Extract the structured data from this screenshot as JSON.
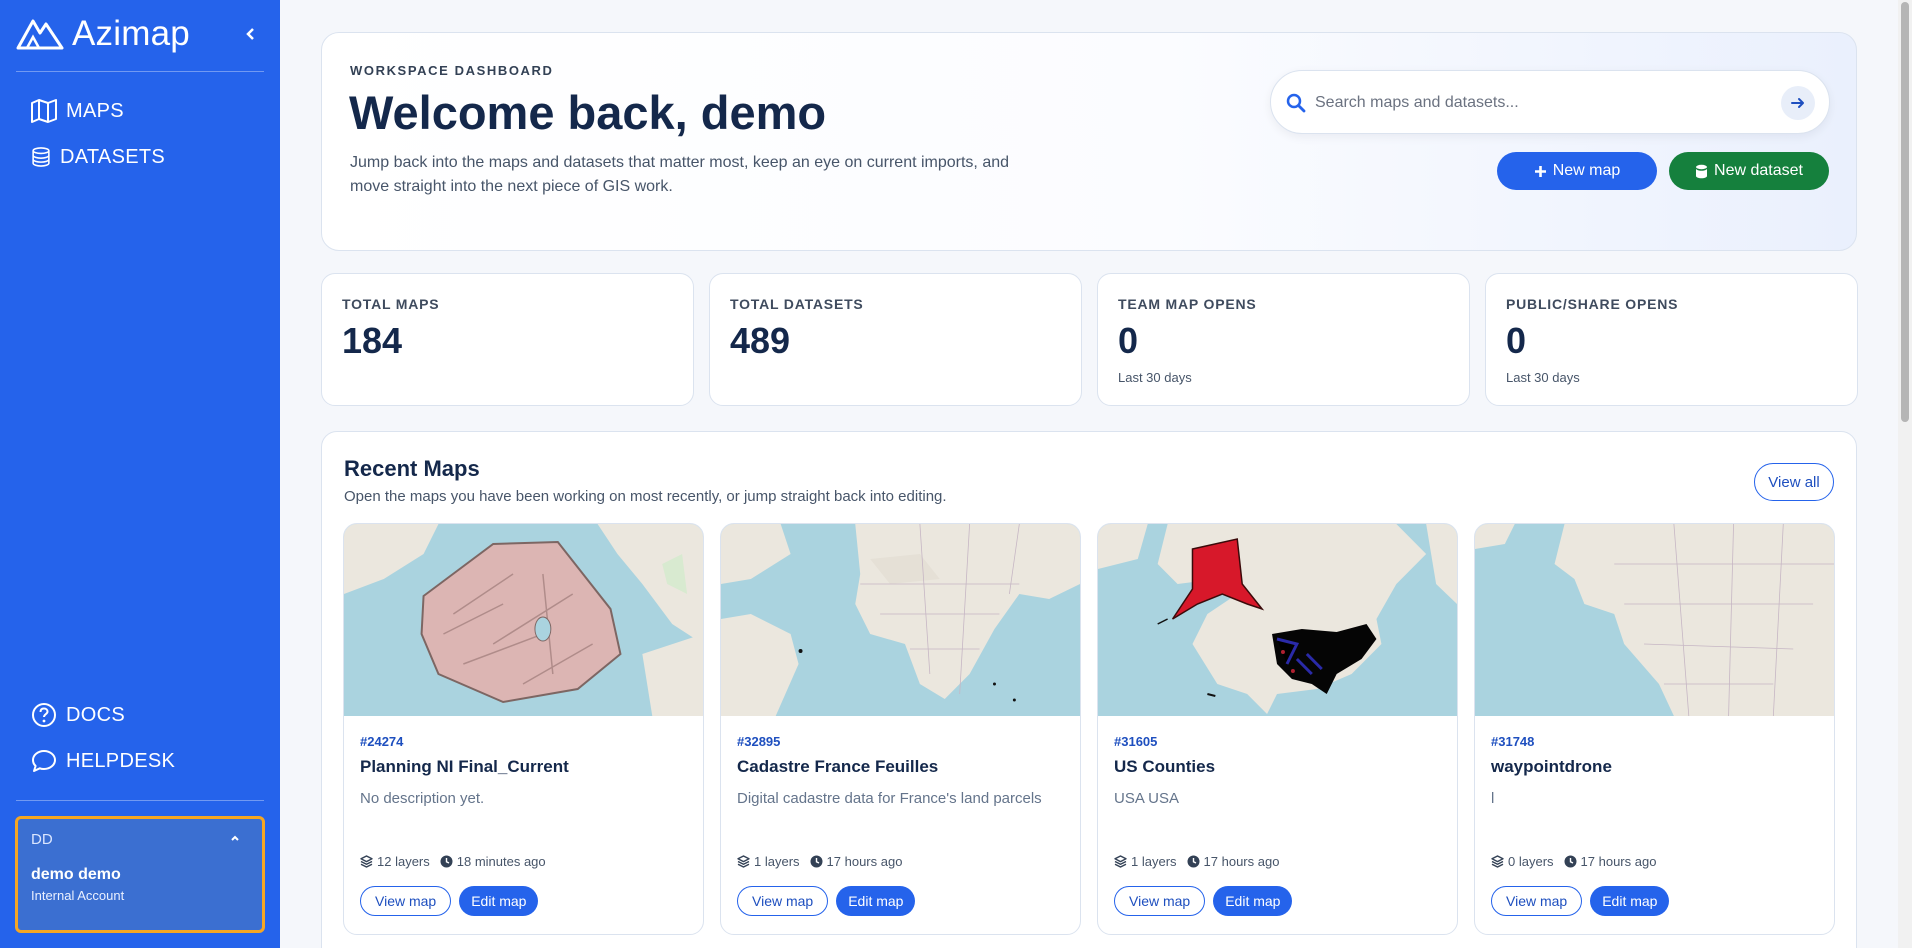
{
  "sidebar": {
    "brand": "Azimap",
    "nav": [
      {
        "label": "MAPS",
        "icon": "map-icon"
      },
      {
        "label": "DATASETS",
        "icon": "database-icon"
      }
    ],
    "footer_nav": [
      {
        "label": "DOCS",
        "icon": "question-circle-icon"
      },
      {
        "label": "HELPDESK",
        "icon": "chat-bubble-icon"
      }
    ],
    "user": {
      "initials": "DD",
      "name": "demo demo",
      "role": "Internal Account"
    }
  },
  "hero": {
    "eyebrow": "WORKSPACE DASHBOARD",
    "title": "Welcome back, demo",
    "description": "Jump back into the maps and datasets that matter most, keep an eye on current imports, and move straight into the next piece of GIS work.",
    "search_placeholder": "Search maps and datasets...",
    "new_map_label": "New map",
    "new_dataset_label": "New dataset"
  },
  "stats": [
    {
      "label": "TOTAL MAPS",
      "value": "184",
      "sub": ""
    },
    {
      "label": "TOTAL DATASETS",
      "value": "489",
      "sub": ""
    },
    {
      "label": "TEAM MAP OPENS",
      "value": "0",
      "sub": "Last 30 days"
    },
    {
      "label": "PUBLIC/SHARE OPENS",
      "value": "0",
      "sub": "Last 30 days"
    }
  ],
  "recent": {
    "title": "Recent Maps",
    "subtitle": "Open the maps you have been working on most recently, or jump straight back into editing.",
    "view_all": "View all",
    "view_label": "View map",
    "edit_label": "Edit map",
    "cards": [
      {
        "id": "#24274",
        "title": "Planning NI Final_Current",
        "description": "No description yet.",
        "layers": "12 layers",
        "updated": "18 minutes ago"
      },
      {
        "id": "#32895",
        "title": "Cadastre France Feuilles",
        "description": "Digital cadastre data for France's land parcels",
        "layers": "1 layers",
        "updated": "17 hours ago"
      },
      {
        "id": "#31605",
        "title": "US Counties",
        "description": "USA USA",
        "layers": "1 layers",
        "updated": "17 hours ago"
      },
      {
        "id": "#31748",
        "title": "waypointdrone",
        "description": "l",
        "layers": "0 layers",
        "updated": "17 hours ago"
      }
    ]
  },
  "colors": {
    "sidebar": "#2563eb",
    "primary": "#2563eb",
    "success": "#15803d",
    "highlight_border": "#f5a623",
    "heading": "#14284b"
  }
}
